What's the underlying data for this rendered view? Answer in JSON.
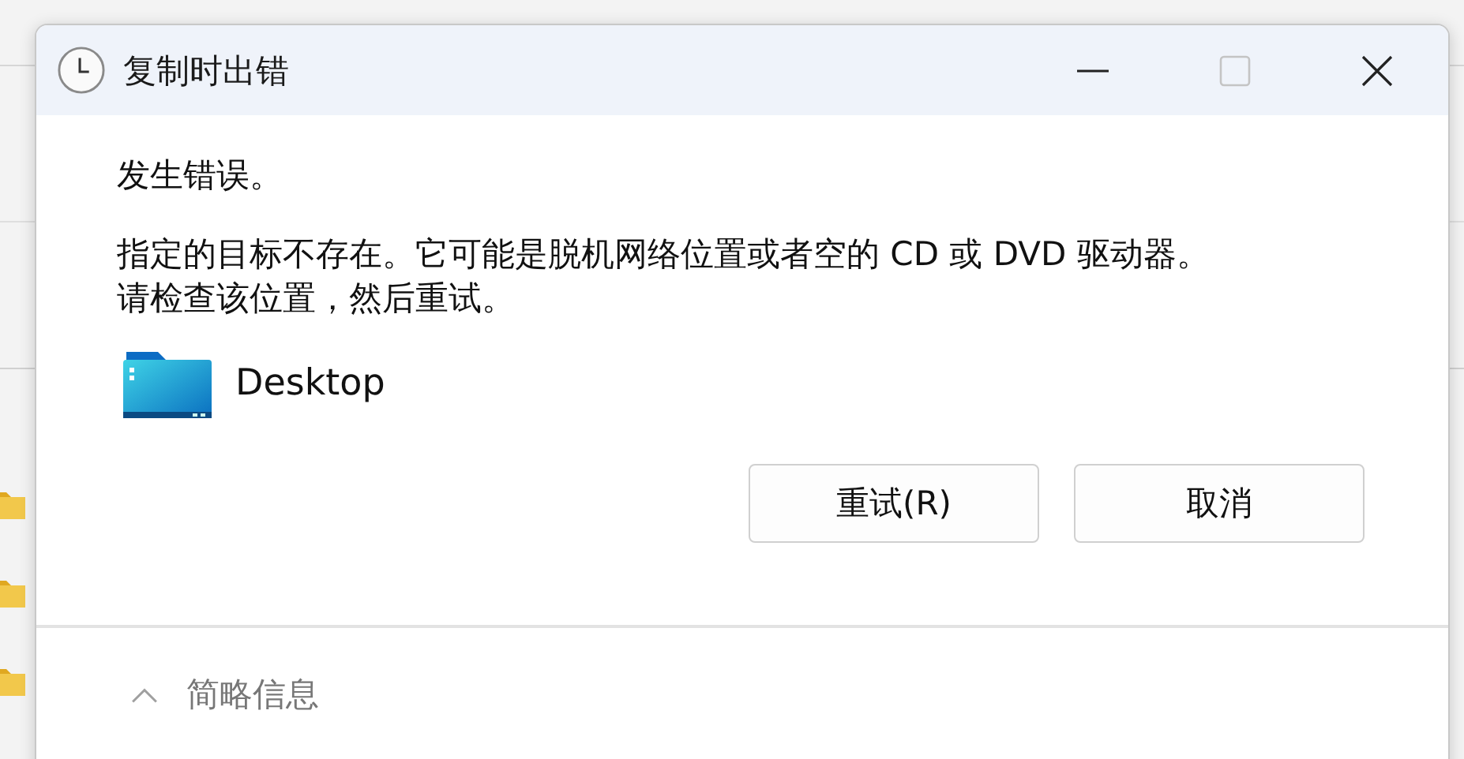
{
  "window": {
    "title": "复制时出错"
  },
  "message": {
    "heading": "发生错误。",
    "detail_lines": [
      "指定的目标不存在。它可能是脱机网络位置或者空的 CD 或 DVD 驱动器。",
      "请检查该位置，然后重试。"
    ]
  },
  "item": {
    "name": "Desktop"
  },
  "buttons": [
    {
      "label": "重试(R)"
    },
    {
      "label": "取消"
    }
  ],
  "details_toggle": {
    "label": "简略信息",
    "expanded": true
  }
}
